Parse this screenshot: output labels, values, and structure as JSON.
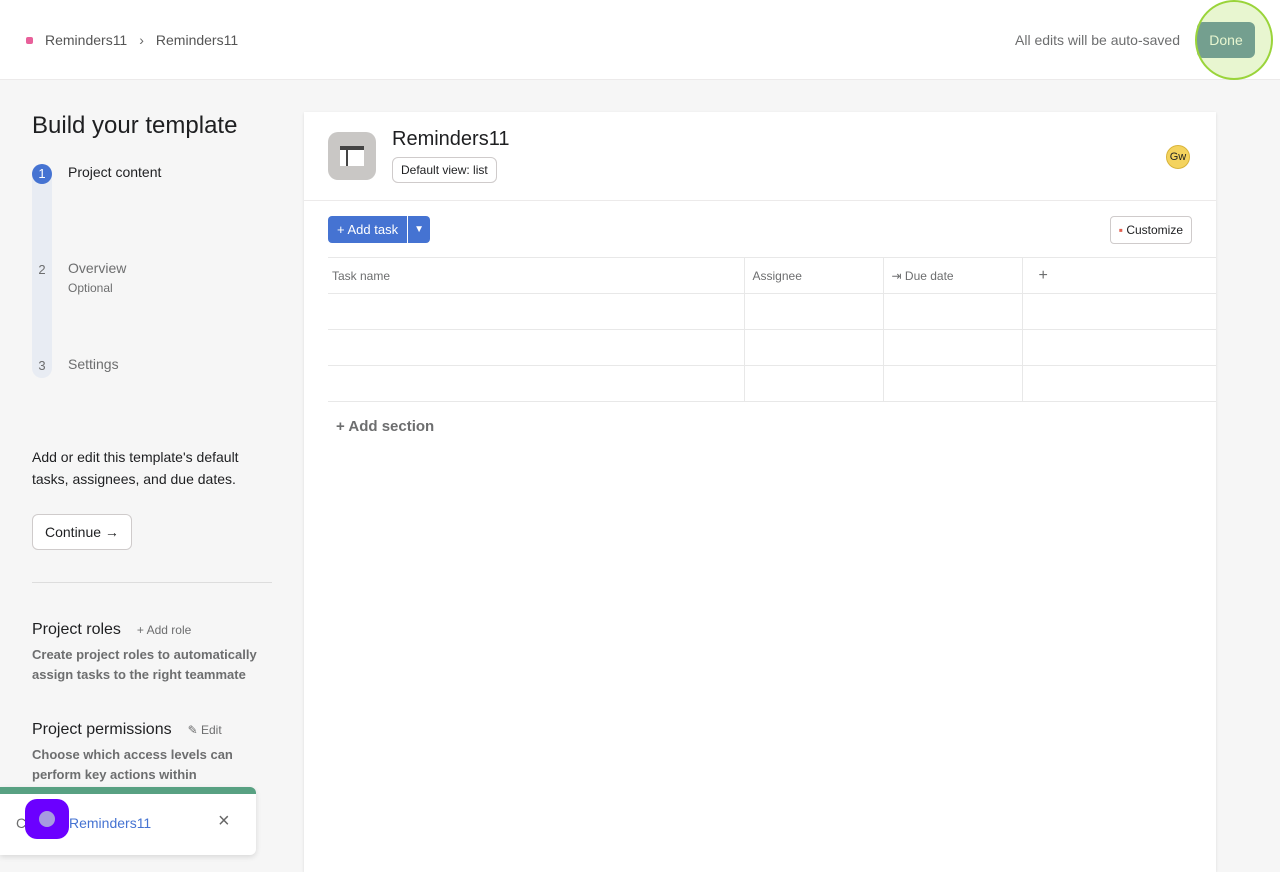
{
  "breadcrumb": [
    "Reminders11",
    "Reminders11"
  ],
  "header": {
    "autosave": "All edits will be auto-saved",
    "done": "Done"
  },
  "left": {
    "title": "Build your template",
    "steps": [
      {
        "n": "1",
        "label": "Project content"
      },
      {
        "n": "2",
        "label": "Overview",
        "sub": "Optional"
      },
      {
        "n": "3",
        "label": "Settings"
      }
    ],
    "description": "Add or edit this template's default tasks, assignees, and due dates.",
    "continue": "Continue →",
    "roles": {
      "title": "Project roles",
      "action": "+ Add role",
      "desc": "Create project roles to automatically assign tasks to the right teammate"
    },
    "permissions": {
      "title": "Project permissions",
      "action": "✎ Edit",
      "desc": "Choose which access levels can perform key actions within"
    }
  },
  "project": {
    "title": "Reminders11",
    "default_view": "Default view: list",
    "avatar": "Gw",
    "add_task": "+ Add task",
    "customize": "Customize",
    "columns": [
      "Task name",
      "Assignee",
      "Due date",
      "+"
    ],
    "add_section": "+ Add section"
  },
  "toast": {
    "prefix": "C",
    "link": "Reminders11",
    "close": "×"
  }
}
